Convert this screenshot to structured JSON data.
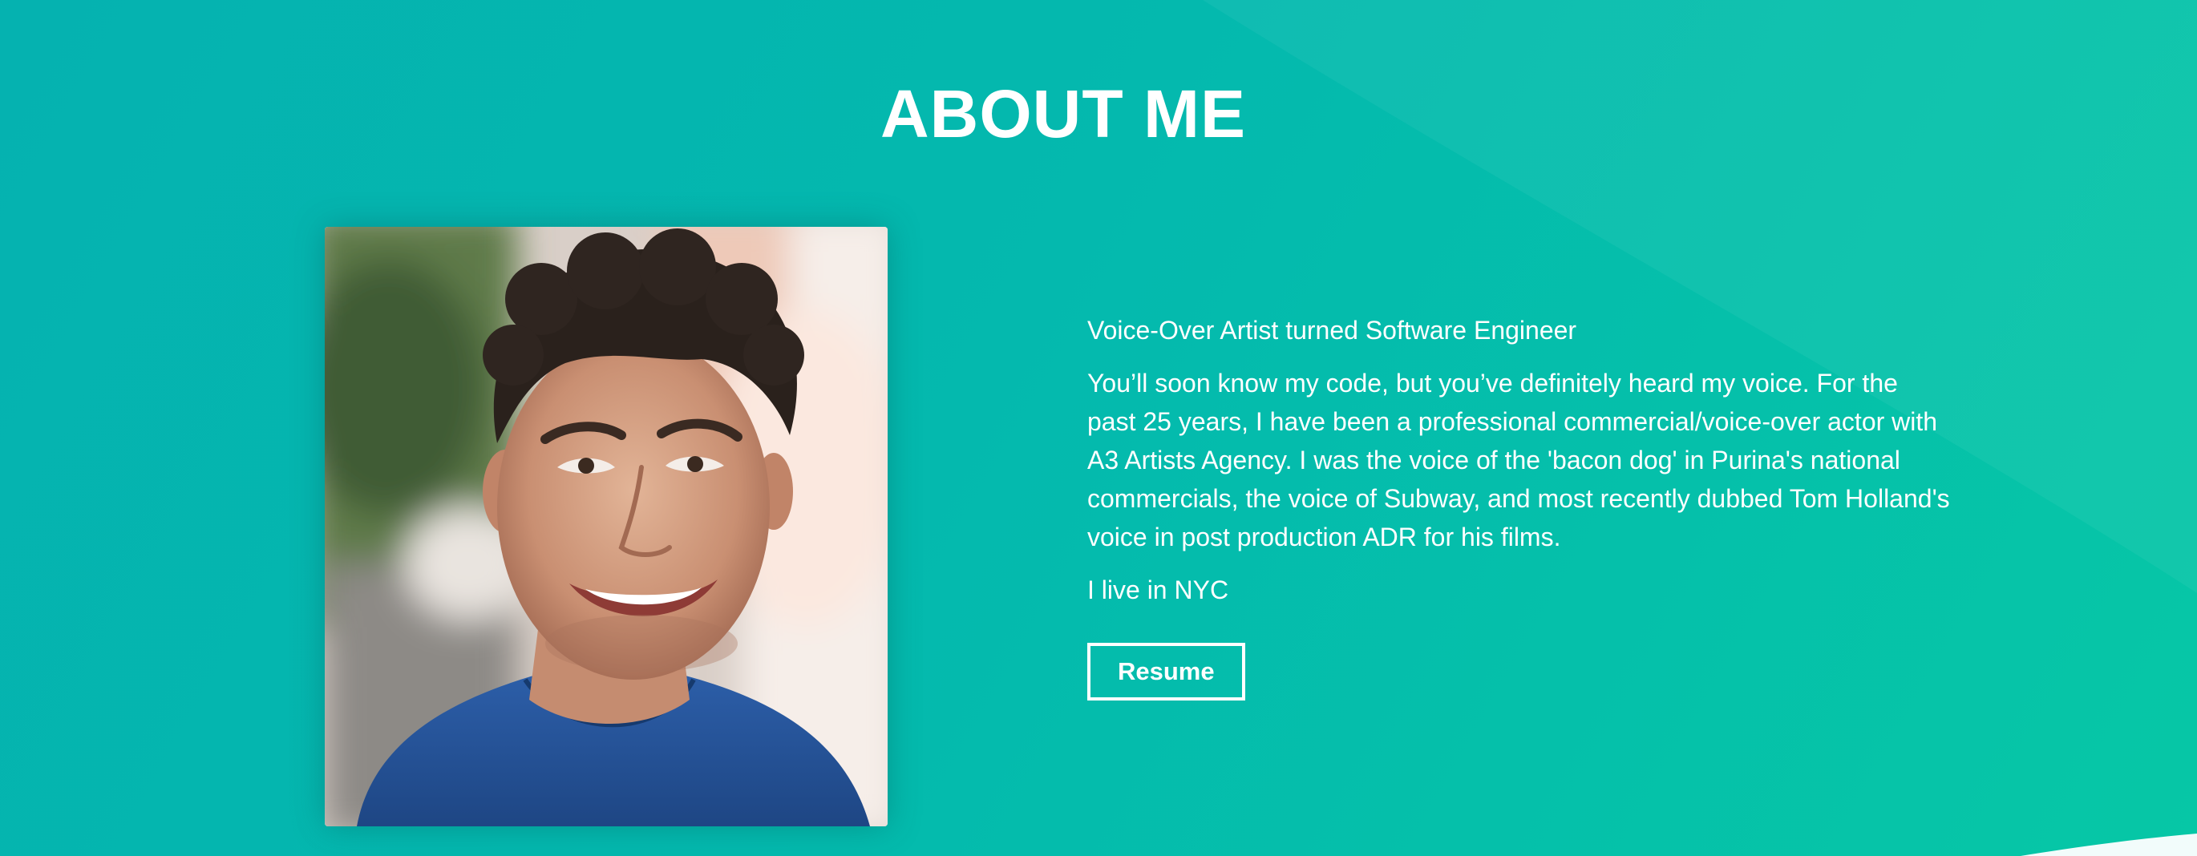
{
  "about": {
    "title": "ABOUT ME",
    "subtitle": "Voice-Over Artist turned Software Engineer",
    "bio": "You’ll soon know my code, but you’ve definitely heard my voice. For the past 25 years, I have been a professional commercial/voice-over actor with A3 Artists Agency. I was the voice of the 'bacon dog' in Purina's national commercials, the voice of Subway, and most recently dubbed Tom Holland's voice in post production ADR for his films.",
    "location": "I live in NYC",
    "resume_label": "Resume"
  },
  "colors": {
    "background_start": "#05b2b0",
    "background_end": "#06c7a6",
    "text": "#ffffff"
  }
}
